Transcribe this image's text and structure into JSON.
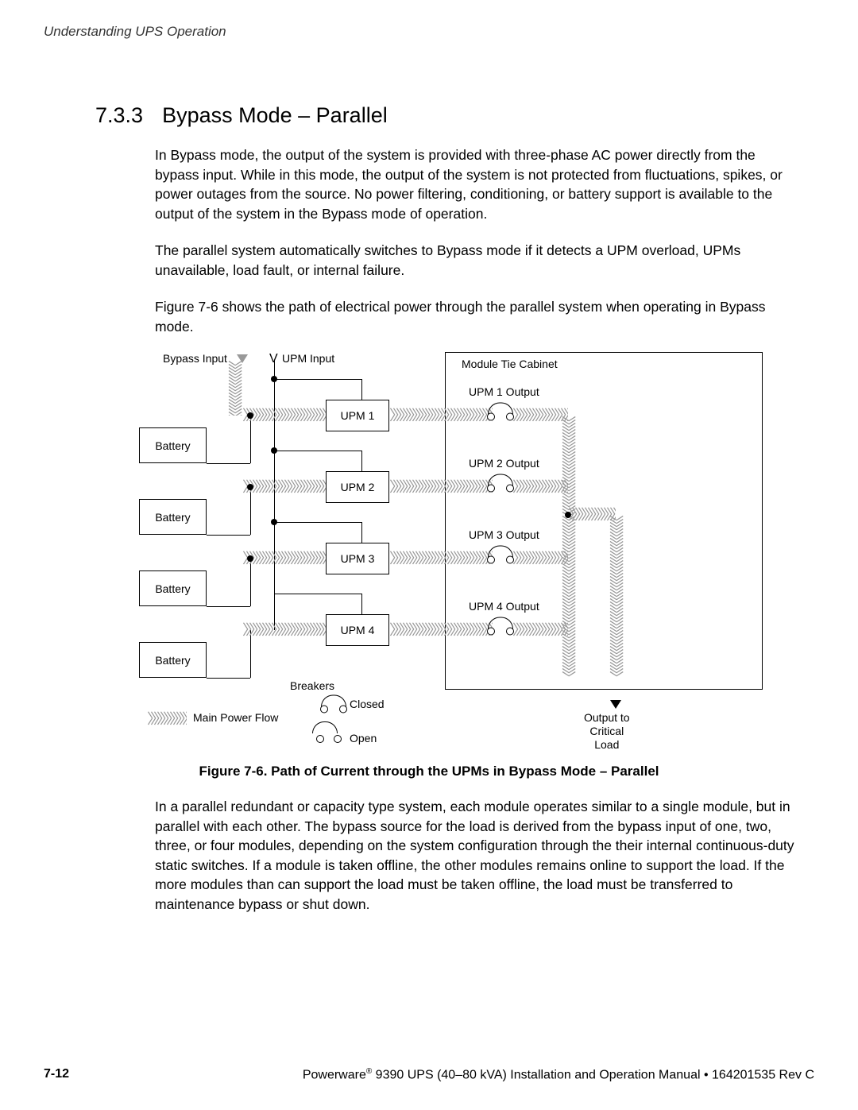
{
  "header": {
    "running": "Understanding UPS Operation"
  },
  "section": {
    "num": "7.3.3",
    "title": "Bypass Mode – Parallel"
  },
  "paragraphs": {
    "p1": "In Bypass mode, the output of the system is provided with three-phase AC power directly from the bypass input. While in this mode, the output of the system is not protected from fluctuations, spikes, or power outages from the source. No power filtering, conditioning, or battery support is available to the output of the system in the Bypass mode of operation.",
    "p2": "The parallel system automatically switches to Bypass mode if it detects a UPM overload, UPMs unavailable, load fault, or internal failure.",
    "p3": "Figure 7-6 shows the path of electrical power through the parallel system when operating in Bypass mode.",
    "p4": "In a parallel redundant or capacity type system, each module operates similar to a single module, but in parallel with each other. The bypass source for the load is derived from the bypass input of one, two, three, or four modules, depending on the system configuration through the their internal continuous-duty static switches. If a module is taken offline, the other modules remains online to support the load. If the more modules than can support the load must be taken offline, the load must be transferred to maintenance bypass or shut down."
  },
  "diagram": {
    "bypass_input": "Bypass Input",
    "upm_input": "UPM Input",
    "battery": "Battery",
    "upm1": "UPM 1",
    "upm2": "UPM 2",
    "upm3": "UPM 3",
    "upm4": "UPM 4",
    "mtc": "Module Tie Cabinet",
    "out1": "UPM 1 Output",
    "out2": "UPM 2 Output",
    "out3": "UPM 3 Output",
    "out4": "UPM 4 Output",
    "breakers": "Breakers",
    "closed": "Closed",
    "open": "Open",
    "mpf": "Main Power Flow",
    "critical": "Output to\nCritical\nLoad"
  },
  "figure_caption": "Figure 7-6. Path of Current through the UPMs in Bypass Mode – Parallel",
  "footer": {
    "page": "7-12",
    "line_a": "Powerware",
    "line_b": " 9390 UPS (40–80 kVA) Installation and Operation Manual  •  164201535 Rev C",
    "reg": "®"
  }
}
